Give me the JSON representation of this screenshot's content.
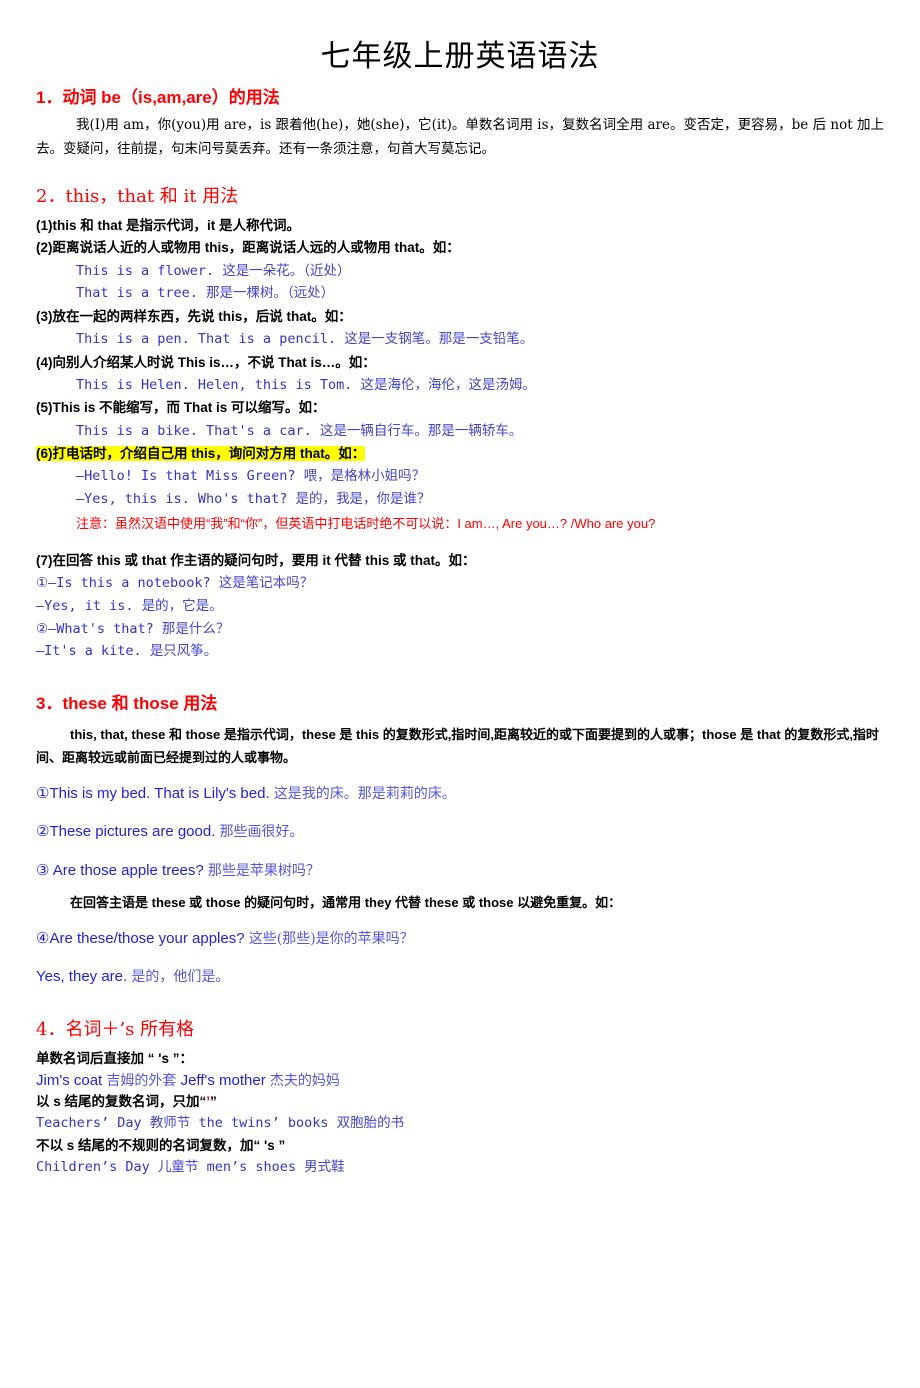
{
  "document": {
    "title": "七年级上册英语语法"
  },
  "sections": [
    {
      "id": "s1",
      "heading": "1．动词 be（is,am,are）的用法",
      "body": "我(I)用 am，你(you)用 are，is 跟着他(he)，她(she)，它(it)。单数名词用 is，复数名词全用 are。变否定，更容易，be 后 not 加上去。变疑问，往前提，句末问号莫丢弃。还有一条须注意，句首大写莫忘记。"
    },
    {
      "id": "s2",
      "heading": "2．this，that 和 it 用法",
      "items": [
        {
          "label": "(1)this 和 that 是指示代词，it 是人称代词。"
        },
        {
          "label": "(2)距离说话人近的人或物用 this，距离说话人远的人或物用 that。如："
        },
        {
          "label": "(3)放在一起的两样东西，先说 this，后说 that。如："
        },
        {
          "label": "(4)向别人介绍某人时说 This is…，不说 That is…。如："
        },
        {
          "label": "(5)This is  不能缩写，而 That is 可以缩写。如："
        },
        {
          "label": "(6)打电话时，介绍自己用 this，询问对方用 that。如："
        },
        {
          "label": "(7)在回答 this 或 that 作主语的疑问句时，要用 it 代替 this 或 that。如："
        }
      ],
      "examples": {
        "e2_1_en": "This is a flower.",
        "e2_1_cn": "这是一朵花。（近处）",
        "e2_2_en": "That is a tree.",
        "e2_2_cn": "那是一棵树。（远处）",
        "e3_1_en": "This is a pen.  That is a pencil.",
        "e3_1_cn": "这是一支钢笔。那是一支铅笔。",
        "e4_1_en": "This is Helen.  Helen, this is Tom.",
        "e4_1_cn": "这是海伦，海伦，这是汤姆。",
        "e5_1_en": "This is a bike.  That's a car.",
        "e5_1_cn": "这是一辆自行车。那是一辆轿车。",
        "e6_1_en": "—Hello! Is that Miss Green?",
        "e6_1_cn": "喂，是格林小姐吗？",
        "e6_2_en": "—Yes, this is. Who's that?",
        "e6_2_cn": "是的，我是，你是谁？",
        "e6_note": "注意：虽然汉语中使用“我”和“你”，但英语中打电话时绝不可以说：I am…, Are you…? /Who are you?",
        "e7_1_en": "①—Is this a notebook?",
        "e7_1_cn": "这是笔记本吗？",
        "e7_2_en": "—Yes, it is.",
        "e7_2_cn": "是的，它是。",
        "e7_3_en": "②—What's that?",
        "e7_3_cn": "那是什么？",
        "e7_4_en": "—It's a kite.",
        "e7_4_cn": "是只风筝。"
      }
    },
    {
      "id": "s3",
      "heading": "3．these 和 those 用法",
      "intro": "this, that, these 和 those 是指示代词，these 是 this 的复数形式,指时间,距离较近的或下面要提到的人或事；those 是 that 的复数形式,指时间、距离较远或前面已经提到过的人或事物。",
      "ex1_en": "①This is my bed. That is Lily's bed.",
      "ex1_cn": "这是我的床。那是莉莉的床。",
      "ex2_en": "②These pictures are good.",
      "ex2_cn": "那些画很好。",
      "ex3_en": "③ Are those apple trees?",
      "ex3_cn": "那些是苹果树吗？",
      "note": "在回答主语是 these 或 those 的疑问句时，通常用 they 代替 these 或 those 以避免重复。如：",
      "ex4_en": "④Are these/those your apples?",
      "ex4_cn": "这些(那些)是你的苹果吗？",
      "ex5_en": "Yes, they are.",
      "ex5_cn": "是的，他们是。"
    },
    {
      "id": "s4",
      "heading": "4．名词＋’s 所有格",
      "rule1": "单数名词后直接加 “ 's ”：",
      "ex1_en1": "Jim's coat",
      "ex1_cn1": "吉姆的外套",
      "ex1_en2": "Jeff's mother",
      "ex1_cn2": "杰夫的妈妈",
      "rule2_pre": "以 s 结尾的复数名词，只加“",
      "rule2_mark": "’",
      "rule2_post": "”",
      "ex2_en1": "Teachers’ Day",
      "ex2_cn1": "教师节",
      "ex2_en2": "the twins’ books",
      "ex2_cn2": "双胞胎的书",
      "rule3": "不以 s 结尾的不规则的名词复数，加“ 's ”",
      "ex3_en1": "Children’s Day",
      "ex3_cn1": "儿童节",
      "ex3_en2": "men’s shoes",
      "ex3_cn2": "男式鞋"
    }
  ],
  "colors": {
    "heading_red": "#FF0000",
    "example_blue": "#3333CC",
    "sans_blue": "#2222DD",
    "highlight_yellow": "#FFFF00",
    "text_black": "#000000"
  }
}
